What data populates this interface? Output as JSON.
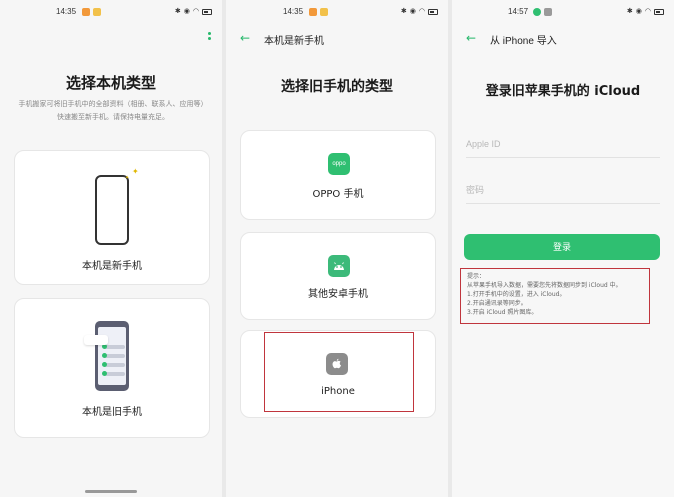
{
  "screen1": {
    "time": "14:35",
    "title": "选择本机类型",
    "description": "手机搬家可将旧手机中的全部资料（相册、联系人、应用等）快速搬至新手机。请保持电量充足。",
    "cards": [
      {
        "label": "本机是新手机"
      },
      {
        "label": "本机是旧手机"
      }
    ]
  },
  "screen2": {
    "time": "14:35",
    "nav_title": "本机是新手机",
    "title": "选择旧手机的类型",
    "oppo_icon_text": "oppo",
    "cards": [
      {
        "label": "OPPO 手机",
        "icon": "oppo-icon"
      },
      {
        "label": "其他安卓手机",
        "icon": "android-icon"
      },
      {
        "label": "iPhone",
        "icon": "apple-icon"
      }
    ]
  },
  "screen3": {
    "time": "14:57",
    "nav_title": "从 iPhone 导入",
    "title": "登录旧苹果手机的 iCloud",
    "appleid_placeholder": "Apple ID",
    "password_placeholder": "密码",
    "login_label": "登录",
    "hint": {
      "heading": "提示：",
      "line1": "从苹果手机导入数据，需要您先将数据同步到 iCloud 中。",
      "line2": "1.打开手机中的设置，进入 iCloud。",
      "line3": "2.开启通讯录等同步。",
      "line4": "3.开启 iCloud 照片图库。"
    }
  },
  "colors": {
    "accent": "#2fbf71",
    "highlight": "#c0353d"
  },
  "icons": {
    "more": "more-vertical-icon",
    "back": "back-arrow-icon",
    "apple": "apple-logo-icon",
    "android": "android-icon"
  }
}
